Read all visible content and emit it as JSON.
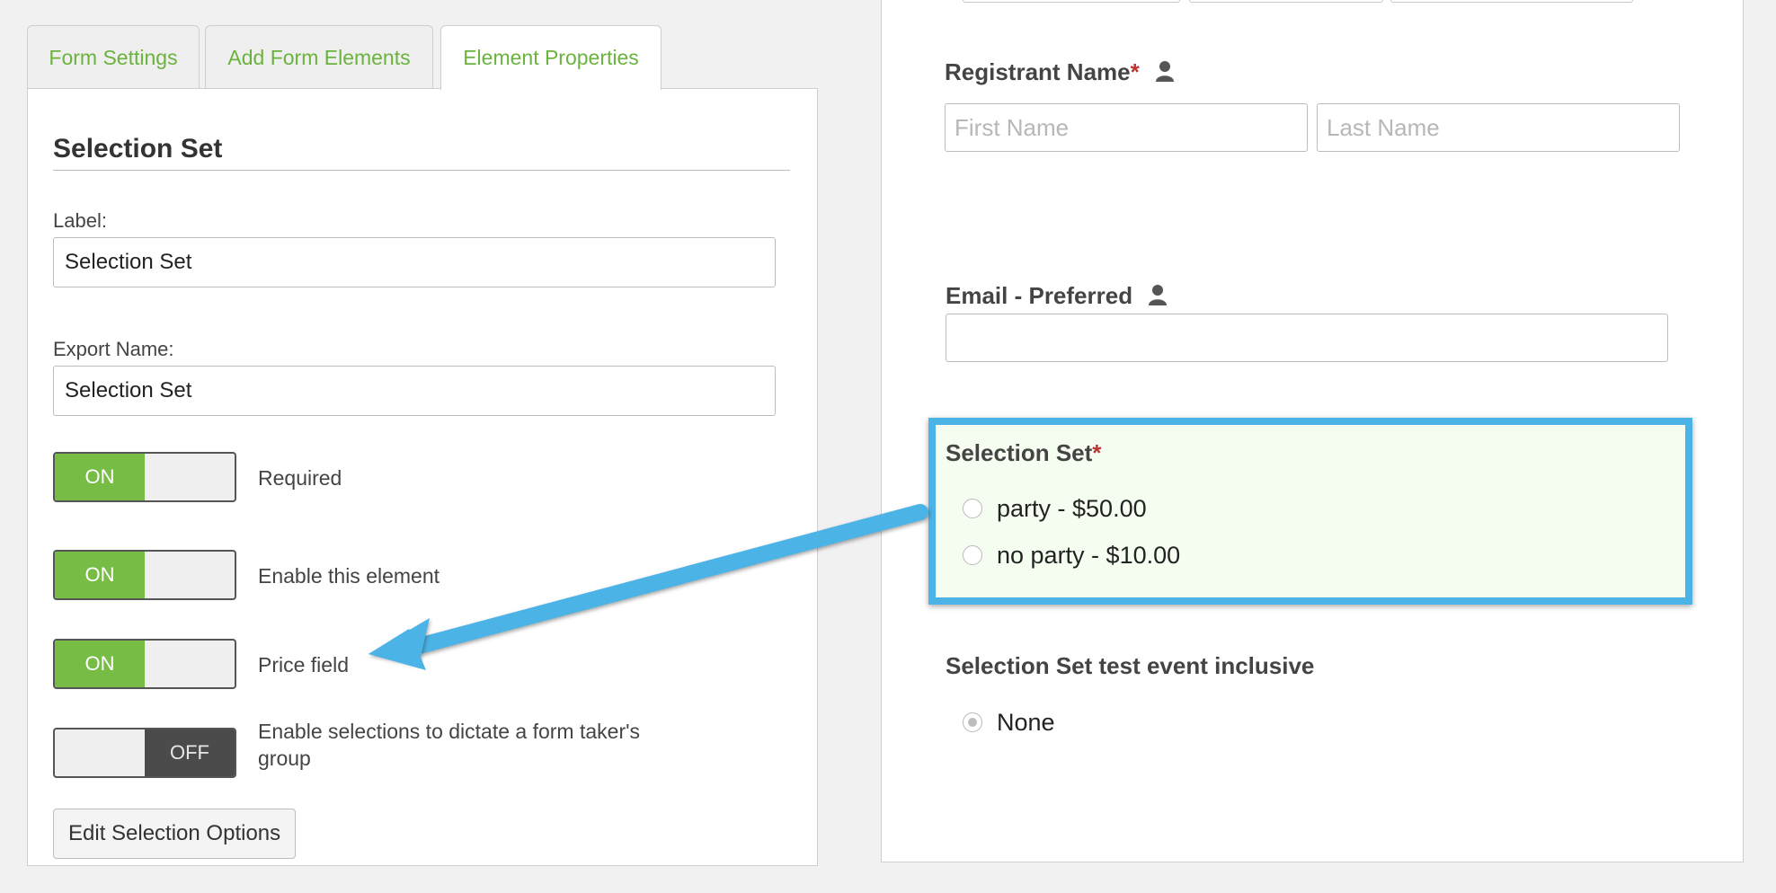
{
  "tabs": [
    {
      "label": "Form Settings"
    },
    {
      "label": "Add Form Elements"
    },
    {
      "label": "Element Properties"
    }
  ],
  "properties": {
    "title": "Selection Set",
    "label_caption": "Label:",
    "label_value": "Selection Set",
    "export_caption": "Export Name:",
    "export_value": "Selection Set",
    "toggles": [
      {
        "state": "ON",
        "label": "Required"
      },
      {
        "state": "ON",
        "label": "Enable this element"
      },
      {
        "state": "ON",
        "label": "Price field"
      },
      {
        "state": "OFF",
        "label": "Enable selections to dictate a form taker's group"
      }
    ],
    "edit_button": "Edit Selection Options"
  },
  "form": {
    "registrant": {
      "label": "Registrant Name",
      "required_mark": "*",
      "first_placeholder": "First Name",
      "last_placeholder": "Last Name",
      "icon": "person-icon"
    },
    "email": {
      "label": "Email - Preferred",
      "value": "",
      "icon": "person-icon"
    },
    "selection_set": {
      "label": "Selection Set",
      "required_mark": "*",
      "options": [
        {
          "text": "party - $50.00",
          "checked": false
        },
        {
          "text": "no party - $10.00",
          "checked": false
        }
      ]
    },
    "selection_set_test": {
      "label": "Selection Set test event inclusive",
      "options": [
        {
          "text": "None",
          "checked": true
        }
      ]
    }
  },
  "colors": {
    "accent_green": "#77bd45",
    "tab_text": "#6ab33d",
    "highlight_border": "#4cb3e6",
    "required": "#b33333"
  }
}
